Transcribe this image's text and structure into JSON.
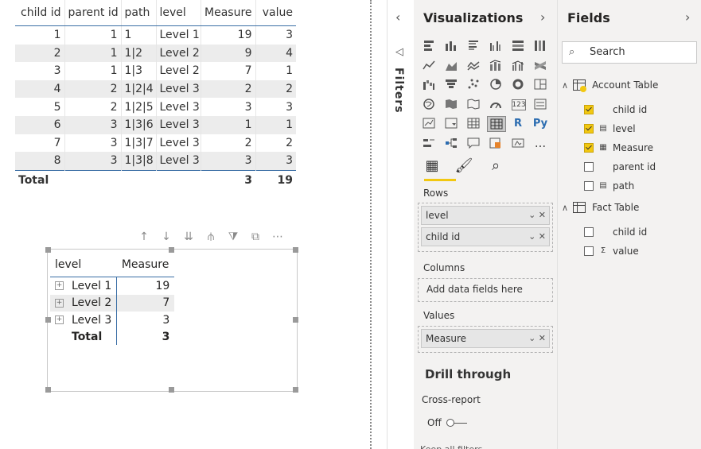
{
  "top_table": {
    "headers": [
      "child id",
      "parent id",
      "path",
      "level",
      "Measure",
      "value"
    ],
    "rows": [
      [
        "1",
        "1",
        "1",
        "Level 1",
        "19",
        "3"
      ],
      [
        "2",
        "1",
        "1|2",
        "Level 2",
        "9",
        "4"
      ],
      [
        "3",
        "1",
        "1|3",
        "Level 2",
        "7",
        "1"
      ],
      [
        "4",
        "2",
        "1|2|4",
        "Level 3",
        "2",
        "2"
      ],
      [
        "5",
        "2",
        "1|2|5",
        "Level 3",
        "3",
        "3"
      ],
      [
        "6",
        "3",
        "1|3|6",
        "Level 3",
        "1",
        "1"
      ],
      [
        "7",
        "3",
        "1|3|7",
        "Level 3",
        "2",
        "2"
      ],
      [
        "8",
        "3",
        "1|3|8",
        "Level 3",
        "3",
        "3"
      ]
    ],
    "total": {
      "label": "Total",
      "measure": "3",
      "value": "19"
    }
  },
  "matrix": {
    "headers": [
      "level",
      "Measure"
    ],
    "rows": [
      {
        "label": "Level 1",
        "measure": "19",
        "expander": "+"
      },
      {
        "label": "Level 2",
        "measure": "7",
        "expander": "+"
      },
      {
        "label": "Level 3",
        "measure": "3",
        "expander": "+"
      }
    ],
    "total": {
      "label": "Total",
      "measure": "3"
    }
  },
  "visual_header_icons": [
    "arrow-up-icon",
    "arrow-down-icon",
    "double-arrow-down-icon",
    "expand-hierarchy-icon",
    "filter-icon",
    "focus-mode-icon",
    "more-options-icon"
  ],
  "filters": {
    "label": "Filters"
  },
  "visualizations": {
    "title": "Visualizations",
    "tabs": [
      "fields-tab-icon",
      "format-paintbrush-icon",
      "analytics-magnifier-icon"
    ],
    "python_label": "Py",
    "r_label": "R",
    "more_label": "...",
    "rows_label": "Rows",
    "rows": [
      "level",
      "child id"
    ],
    "columns_label": "Columns",
    "columns_placeholder": "Add data fields here",
    "values_label": "Values",
    "values": [
      "Measure"
    ],
    "drill_through": "Drill through",
    "cross_report": "Cross-report",
    "toggle_state": "Off",
    "cut_text": "Keep all filters"
  },
  "fields": {
    "title": "Fields",
    "search_placeholder": "Search",
    "tables": [
      {
        "name": "Account Table",
        "items": [
          {
            "name": "child id",
            "checked": true,
            "icon": ""
          },
          {
            "name": "level",
            "checked": true,
            "icon": "hierarchy-icon"
          },
          {
            "name": "Measure",
            "checked": true,
            "icon": "calculator-icon"
          },
          {
            "name": "parent id",
            "checked": false,
            "icon": ""
          },
          {
            "name": "path",
            "checked": false,
            "icon": "hierarchy-icon"
          }
        ]
      },
      {
        "name": "Fact Table",
        "items": [
          {
            "name": "child id",
            "checked": false,
            "icon": ""
          },
          {
            "name": "value",
            "checked": false,
            "icon": "sigma-icon"
          }
        ]
      }
    ]
  }
}
